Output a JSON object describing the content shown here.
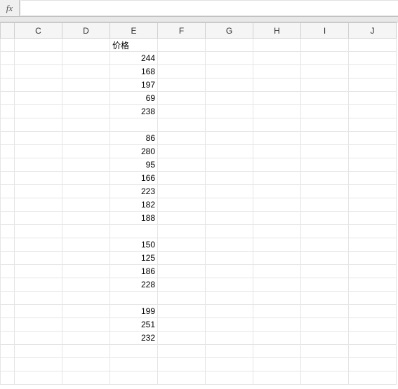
{
  "formula_bar": {
    "fx_label": "fx",
    "value": ""
  },
  "columns": [
    "C",
    "D",
    "E",
    "F",
    "G",
    "H",
    "I",
    "J"
  ],
  "chart_data": {
    "type": "table",
    "header": "价格",
    "values": [
      244,
      168,
      197,
      69,
      238,
      null,
      86,
      280,
      95,
      166,
      223,
      182,
      188,
      null,
      150,
      125,
      186,
      228,
      null,
      199,
      251,
      232
    ]
  }
}
